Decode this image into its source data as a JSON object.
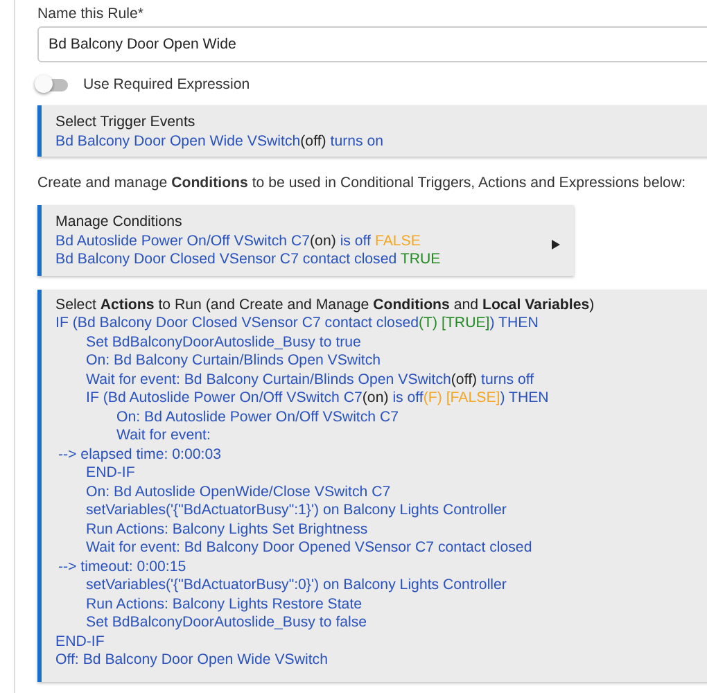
{
  "rule_name": {
    "label": "Name this Rule*",
    "value": "Bd Balcony Door Open Wide"
  },
  "required_expression": {
    "label": "Use Required Expression",
    "on": false
  },
  "trigger_events": {
    "title": "Select Trigger Events",
    "lines": [
      {
        "segments": [
          {
            "text": "Bd Balcony Door Open Wide VSwitch",
            "color": "#2a52be"
          },
          {
            "text": "(off)",
            "color": "#222222"
          },
          {
            "text": " turns on",
            "color": "#2a52be"
          }
        ]
      }
    ]
  },
  "conditions_intro": "Create and manage **Conditions** to be used in Conditional Triggers, Actions and Expressions below:",
  "manage_conditions": {
    "title": "Manage Conditions",
    "expandable": true,
    "lines": [
      {
        "segments": [
          {
            "text": "Bd Autoslide Power On/Off VSwitch C7",
            "color": "#2a52be"
          },
          {
            "text": "(on)",
            "color": "#222222"
          },
          {
            "text": " is off ",
            "color": "#2a52be"
          },
          {
            "text": "FALSE",
            "color": "#f5a623"
          }
        ]
      },
      {
        "segments": [
          {
            "text": "Bd Balcony Door Closed VSensor C7 contact closed ",
            "color": "#2a52be"
          },
          {
            "text": "TRUE",
            "color": "#1f8a1f"
          }
        ]
      }
    ]
  },
  "actions": {
    "title": "Select **Actions** to Run (and Create and Manage **Conditions** and **Local Variables**)",
    "lines": [
      {
        "kind": "statement",
        "segments": [
          {
            "text": "IF (Bd Balcony Door Closed VSensor C7 contact closed",
            "color": "#2a52be"
          },
          {
            "text": "(T) [TRUE]",
            "color": "#1f8a1f"
          },
          {
            "text": ") THEN",
            "color": "#2a52be"
          }
        ],
        "children": [
          {
            "kind": "statement",
            "segments": [
              {
                "text": "Set BdBalconyDoorAutoslide_Busy to true",
                "color": "#2a52be"
              }
            ]
          },
          {
            "kind": "statement",
            "segments": [
              {
                "text": "On: Bd Balcony Curtain/Blinds Open VSwitch",
                "color": "#2a52be"
              }
            ]
          },
          {
            "kind": "statement",
            "segments": [
              {
                "text": "Wait for event: Bd Balcony Curtain/Blinds Open VSwitch",
                "color": "#2a52be"
              },
              {
                "text": "(off)",
                "color": "#222222"
              },
              {
                "text": " turns off",
                "color": "#2a52be"
              }
            ]
          },
          {
            "kind": "statement",
            "segments": [
              {
                "text": "IF (Bd Autoslide Power On/Off VSwitch C7",
                "color": "#2a52be"
              },
              {
                "text": "(on)",
                "color": "#222222"
              },
              {
                "text": " is off",
                "color": "#2a52be"
              },
              {
                "text": "(F) [FALSE]",
                "color": "#f5a623"
              },
              {
                "text": ") THEN",
                "color": "#2a52be"
              }
            ],
            "children": [
              {
                "kind": "statement",
                "segments": [
                  {
                    "text": "On: Bd Autoslide Power On/Off VSwitch C7",
                    "color": "#2a52be"
                  }
                ]
              },
              {
                "kind": "statement",
                "segments": [
                  {
                    "text": "Wait for event:",
                    "color": "#2a52be"
                  }
                ]
              }
            ]
          },
          {
            "kind": "note",
            "segments": [
              {
                "text": "--> elapsed time: 0:00:03",
                "color": "#2a52be"
              }
            ]
          },
          {
            "kind": "statement",
            "segments": [
              {
                "text": "END-IF",
                "color": "#2a52be"
              }
            ]
          },
          {
            "kind": "statement",
            "segments": [
              {
                "text": "On: Bd Autoslide OpenWide/Close VSwitch C7",
                "color": "#2a52be"
              }
            ]
          },
          {
            "kind": "statement",
            "segments": [
              {
                "text": "setVariables('{\"BdActuatorBusy\":1}') on Balcony Lights Controller",
                "color": "#2a52be"
              }
            ]
          },
          {
            "kind": "statement",
            "segments": [
              {
                "text": "Run Actions: Balcony Lights Set Brightness",
                "color": "#2a52be"
              }
            ]
          },
          {
            "kind": "statement",
            "segments": [
              {
                "text": "Wait for event: Bd Balcony Door Opened VSensor C7 contact closed",
                "color": "#2a52be"
              }
            ]
          },
          {
            "kind": "note",
            "segments": [
              {
                "text": "--> timeout: 0:00:15",
                "color": "#2a52be"
              }
            ]
          },
          {
            "kind": "statement",
            "segments": [
              {
                "text": "setVariables('{\"BdActuatorBusy\":0}') on Balcony Lights Controller",
                "color": "#2a52be"
              }
            ]
          },
          {
            "kind": "statement",
            "segments": [
              {
                "text": "Run Actions: Balcony Lights Restore State",
                "color": "#2a52be"
              }
            ]
          },
          {
            "kind": "statement",
            "segments": [
              {
                "text": "Set BdBalconyDoorAutoslide_Busy to false",
                "color": "#2a52be"
              }
            ]
          }
        ]
      },
      {
        "kind": "statement",
        "segments": [
          {
            "text": "END-IF",
            "color": "#2a52be"
          }
        ]
      },
      {
        "kind": "statement",
        "segments": [
          {
            "text": "Off: Bd Balcony Door Open Wide VSwitch",
            "color": "#2a52be"
          }
        ]
      }
    ]
  }
}
